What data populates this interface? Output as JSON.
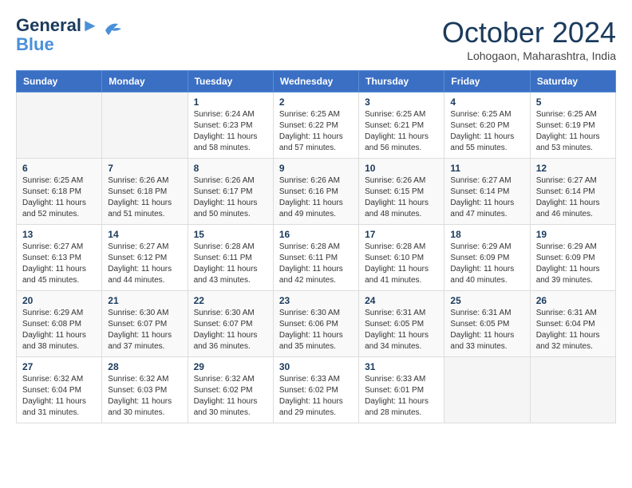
{
  "header": {
    "logo_line1": "General",
    "logo_line2": "Blue",
    "month_title": "October 2024",
    "location": "Lohogaon, Maharashtra, India"
  },
  "weekdays": [
    "Sunday",
    "Monday",
    "Tuesday",
    "Wednesday",
    "Thursday",
    "Friday",
    "Saturday"
  ],
  "weeks": [
    [
      {
        "day": "",
        "info": ""
      },
      {
        "day": "",
        "info": ""
      },
      {
        "day": "1",
        "info": "Sunrise: 6:24 AM\nSunset: 6:23 PM\nDaylight: 11 hours and 58 minutes."
      },
      {
        "day": "2",
        "info": "Sunrise: 6:25 AM\nSunset: 6:22 PM\nDaylight: 11 hours and 57 minutes."
      },
      {
        "day": "3",
        "info": "Sunrise: 6:25 AM\nSunset: 6:21 PM\nDaylight: 11 hours and 56 minutes."
      },
      {
        "day": "4",
        "info": "Sunrise: 6:25 AM\nSunset: 6:20 PM\nDaylight: 11 hours and 55 minutes."
      },
      {
        "day": "5",
        "info": "Sunrise: 6:25 AM\nSunset: 6:19 PM\nDaylight: 11 hours and 53 minutes."
      }
    ],
    [
      {
        "day": "6",
        "info": "Sunrise: 6:25 AM\nSunset: 6:18 PM\nDaylight: 11 hours and 52 minutes."
      },
      {
        "day": "7",
        "info": "Sunrise: 6:26 AM\nSunset: 6:18 PM\nDaylight: 11 hours and 51 minutes."
      },
      {
        "day": "8",
        "info": "Sunrise: 6:26 AM\nSunset: 6:17 PM\nDaylight: 11 hours and 50 minutes."
      },
      {
        "day": "9",
        "info": "Sunrise: 6:26 AM\nSunset: 6:16 PM\nDaylight: 11 hours and 49 minutes."
      },
      {
        "day": "10",
        "info": "Sunrise: 6:26 AM\nSunset: 6:15 PM\nDaylight: 11 hours and 48 minutes."
      },
      {
        "day": "11",
        "info": "Sunrise: 6:27 AM\nSunset: 6:14 PM\nDaylight: 11 hours and 47 minutes."
      },
      {
        "day": "12",
        "info": "Sunrise: 6:27 AM\nSunset: 6:14 PM\nDaylight: 11 hours and 46 minutes."
      }
    ],
    [
      {
        "day": "13",
        "info": "Sunrise: 6:27 AM\nSunset: 6:13 PM\nDaylight: 11 hours and 45 minutes."
      },
      {
        "day": "14",
        "info": "Sunrise: 6:27 AM\nSunset: 6:12 PM\nDaylight: 11 hours and 44 minutes."
      },
      {
        "day": "15",
        "info": "Sunrise: 6:28 AM\nSunset: 6:11 PM\nDaylight: 11 hours and 43 minutes."
      },
      {
        "day": "16",
        "info": "Sunrise: 6:28 AM\nSunset: 6:11 PM\nDaylight: 11 hours and 42 minutes."
      },
      {
        "day": "17",
        "info": "Sunrise: 6:28 AM\nSunset: 6:10 PM\nDaylight: 11 hours and 41 minutes."
      },
      {
        "day": "18",
        "info": "Sunrise: 6:29 AM\nSunset: 6:09 PM\nDaylight: 11 hours and 40 minutes."
      },
      {
        "day": "19",
        "info": "Sunrise: 6:29 AM\nSunset: 6:09 PM\nDaylight: 11 hours and 39 minutes."
      }
    ],
    [
      {
        "day": "20",
        "info": "Sunrise: 6:29 AM\nSunset: 6:08 PM\nDaylight: 11 hours and 38 minutes."
      },
      {
        "day": "21",
        "info": "Sunrise: 6:30 AM\nSunset: 6:07 PM\nDaylight: 11 hours and 37 minutes."
      },
      {
        "day": "22",
        "info": "Sunrise: 6:30 AM\nSunset: 6:07 PM\nDaylight: 11 hours and 36 minutes."
      },
      {
        "day": "23",
        "info": "Sunrise: 6:30 AM\nSunset: 6:06 PM\nDaylight: 11 hours and 35 minutes."
      },
      {
        "day": "24",
        "info": "Sunrise: 6:31 AM\nSunset: 6:05 PM\nDaylight: 11 hours and 34 minutes."
      },
      {
        "day": "25",
        "info": "Sunrise: 6:31 AM\nSunset: 6:05 PM\nDaylight: 11 hours and 33 minutes."
      },
      {
        "day": "26",
        "info": "Sunrise: 6:31 AM\nSunset: 6:04 PM\nDaylight: 11 hours and 32 minutes."
      }
    ],
    [
      {
        "day": "27",
        "info": "Sunrise: 6:32 AM\nSunset: 6:04 PM\nDaylight: 11 hours and 31 minutes."
      },
      {
        "day": "28",
        "info": "Sunrise: 6:32 AM\nSunset: 6:03 PM\nDaylight: 11 hours and 30 minutes."
      },
      {
        "day": "29",
        "info": "Sunrise: 6:32 AM\nSunset: 6:02 PM\nDaylight: 11 hours and 30 minutes."
      },
      {
        "day": "30",
        "info": "Sunrise: 6:33 AM\nSunset: 6:02 PM\nDaylight: 11 hours and 29 minutes."
      },
      {
        "day": "31",
        "info": "Sunrise: 6:33 AM\nSunset: 6:01 PM\nDaylight: 11 hours and 28 minutes."
      },
      {
        "day": "",
        "info": ""
      },
      {
        "day": "",
        "info": ""
      }
    ]
  ]
}
